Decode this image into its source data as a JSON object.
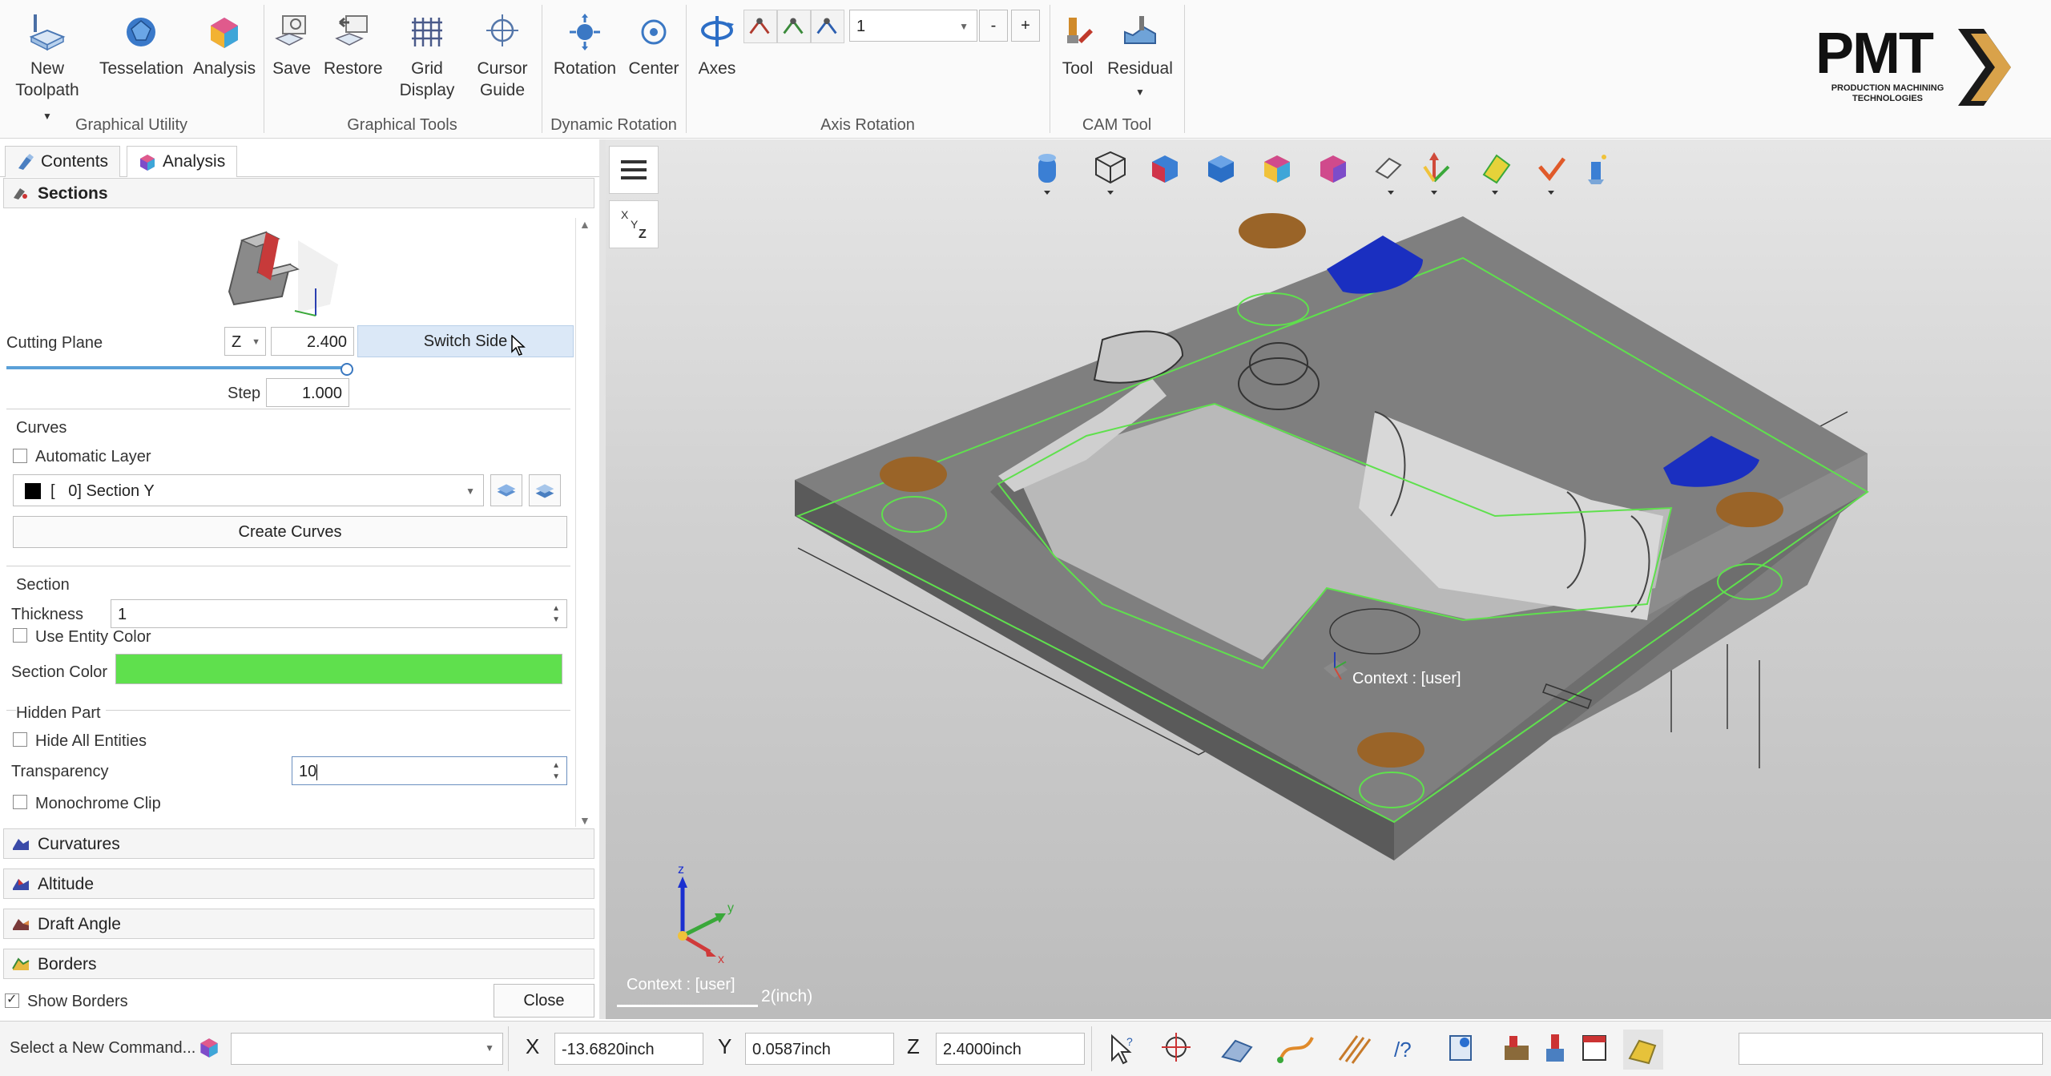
{
  "ribbon": {
    "groups": [
      {
        "label": "Graphical Utility"
      },
      {
        "label": "Graphical Tools"
      },
      {
        "label": "Dynamic Rotation"
      },
      {
        "label": "Axis Rotation"
      },
      {
        "label": "CAM Tool"
      }
    ],
    "buttons": {
      "new_toolpath": "New\nToolpath",
      "tesselation": "Tesselation",
      "analysis": "Analysis",
      "save": "Save",
      "restore": "Restore",
      "grid_display": "Grid\nDisplay",
      "cursor_guide": "Cursor\nGuide",
      "rotation": "Rotation",
      "center": "Center",
      "axes": "Axes",
      "tool": "Tool",
      "residual": "Residual"
    },
    "axis_rotation_value": "1",
    "minus": "-",
    "plus": "+"
  },
  "logo": {
    "text": "PMT",
    "subtitle_line1": "PRODUCTION MACHINING",
    "subtitle_line2": "TECHNOLOGIES"
  },
  "panel": {
    "tabs": [
      {
        "label": "Contents"
      },
      {
        "label": "Analysis"
      }
    ],
    "sections_header": "Sections",
    "cutting_plane_label": "Cutting Plane",
    "axis_value": "Z",
    "cutting_value": "2.400",
    "switch_side": "Switch Side",
    "step_label": "Step",
    "step_value": "1.000",
    "curves_group": "Curves",
    "automatic_layer": "Automatic Layer",
    "layer_value": "[   0] Section Y",
    "create_curves": "Create Curves",
    "section_group": "Section",
    "thickness_label": "Thickness",
    "thickness_value": "1",
    "use_entity_color": "Use Entity Color",
    "section_color_label": "Section Color",
    "section_color": "#5fe04d",
    "hidden_part_group": "Hidden Part",
    "hide_all_entities": "Hide All Entities",
    "transparency_label": "Transparency",
    "transparency_value": "10",
    "monochrome_clip": "Monochrome Clip",
    "other_headers": [
      "Curvatures",
      "Altitude",
      "Draft Angle",
      "Borders"
    ],
    "show_borders": "Show Borders",
    "close": "Close"
  },
  "viewport": {
    "context_label": "Context : [user]",
    "context_triad_label": "Context : [user]",
    "scale_label": "2(inch)",
    "axis_labels": {
      "x": "x",
      "y": "y",
      "z": "z"
    }
  },
  "statusbar": {
    "command_prompt": "Select a New Command...",
    "x_label": "X",
    "x_value": "-13.6820inch",
    "y_label": "Y",
    "y_value": "0.0587inch",
    "z_label": "Z",
    "z_value": "2.4000inch"
  }
}
